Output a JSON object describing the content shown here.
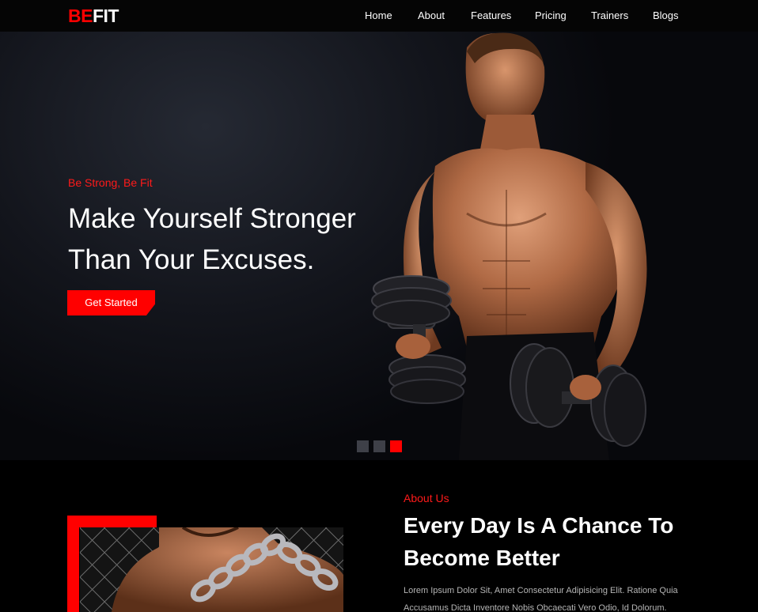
{
  "nav": {
    "logo_be": "BE",
    "logo_fit": "FIT",
    "items": [
      {
        "label": "Home"
      },
      {
        "label": "About"
      },
      {
        "label": "Features"
      },
      {
        "label": "Pricing"
      },
      {
        "label": "Trainers"
      },
      {
        "label": "Blogs"
      }
    ]
  },
  "hero": {
    "tagline": "Be Strong, Be Fit",
    "headline_line1": "Make Yourself Stronger",
    "headline_line2": "Than Your Excuses.",
    "cta_label": "Get Started",
    "slides_count": 3,
    "active_slide": 3
  },
  "about": {
    "label": "About Us",
    "title_line1": "Every Day Is A Chance To",
    "title_line2": "Become Better",
    "text": "Lorem Ipsum Dolor Sit, Amet Consectetur Adipisicing Elit. Ratione Quia Accusamus Dicta Inventore Nobis Obcaecati Vero Odio, Id Dolorum."
  },
  "colors": {
    "accent": "#ff0000",
    "background": "#000000",
    "text": "#ffffff",
    "muted": "#b5b5b5"
  }
}
